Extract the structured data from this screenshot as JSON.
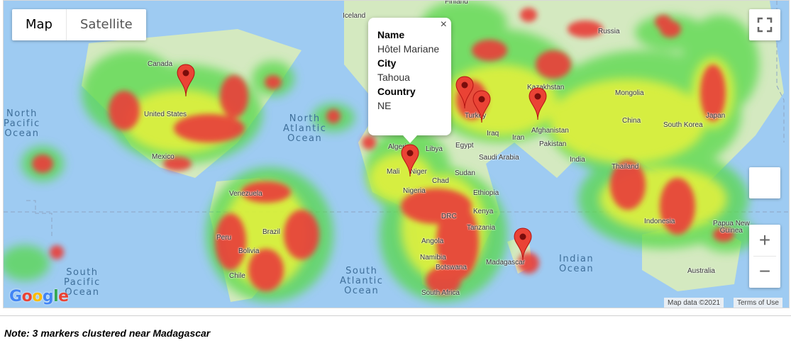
{
  "map_type_control": {
    "map_label": "Map",
    "satellite_label": "Satellite"
  },
  "info_window": {
    "name_key": "Name",
    "name_value": "Hôtel Mariane",
    "city_key": "City",
    "city_value": "Tahoua",
    "country_key": "Country",
    "country_value": "NE",
    "close_glyph": "×"
  },
  "controls": {
    "fullscreen_icon": "fullscreen-icon",
    "zoom_in": "+",
    "zoom_out": "−"
  },
  "places": {
    "finland": "Finland",
    "iceland": "Iceland",
    "russia": "Russia",
    "canada": "Canada",
    "kazakhstan": "Kazakhstan",
    "mongolia": "Mongolia",
    "united_states": "United States",
    "turkey": "Turkey",
    "china": "China",
    "japan": "Japan",
    "south_korea": "South Korea",
    "iraq": "Iraq",
    "iran": "Iran",
    "afghanistan": "Afghanistan",
    "algeria": "Algeria",
    "libya": "Libya",
    "egypt": "Egypt",
    "pakistan": "Pakistan",
    "mexico": "Mexico",
    "saudi_arabia": "Saudi Arabia",
    "india": "India",
    "mali": "Mali",
    "niger": "Niger",
    "sudan": "Sudan",
    "chad": "Chad",
    "thailand": "Thailand",
    "venezuela": "Venezuela",
    "nigeria": "Nigeria",
    "ethiopia": "Ethiopia",
    "kenya": "Kenya",
    "drc": "DRC",
    "tanzania": "Tanzania",
    "indonesia": "Indonesia",
    "papua_new_guinea": "Papua New\nGuinea",
    "peru": "Peru",
    "brazil": "Brazil",
    "bolivia": "Bolivia",
    "angola": "Angola",
    "namibia": "Namibia",
    "madagascar": "Madagascar",
    "botswana": "Botswana",
    "chile": "Chile",
    "australia": "Australia",
    "south_africa": "South Africa"
  },
  "oceans": {
    "north_pacific": "North\nPacific\nOcean",
    "north_atlantic": "North\nAtlantic\nOcean",
    "south_pacific": "South\nPacific\nOcean",
    "south_atlantic": "South\nAtlantic\nOcean",
    "indian": "Indian\nOcean"
  },
  "markers": [
    {
      "name": "marker-canada-great-lakes"
    },
    {
      "name": "marker-niger-tahoua"
    },
    {
      "name": "marker-turkey-1"
    },
    {
      "name": "marker-turkey-2"
    },
    {
      "name": "marker-central-asia"
    },
    {
      "name": "marker-madagascar"
    }
  ],
  "attribution": {
    "map_data": "Map data ©2021",
    "terms": "Terms of Use"
  },
  "logo": "Google",
  "note": "Note: 3 markers clustered near Madagascar",
  "colors": {
    "water": "#9ecbf2",
    "land": "#c9e5b4",
    "heat_red": "#e8413a",
    "heat_yellow": "#e7f23a",
    "heat_green": "#56d84a",
    "marker": "#ea4335"
  }
}
